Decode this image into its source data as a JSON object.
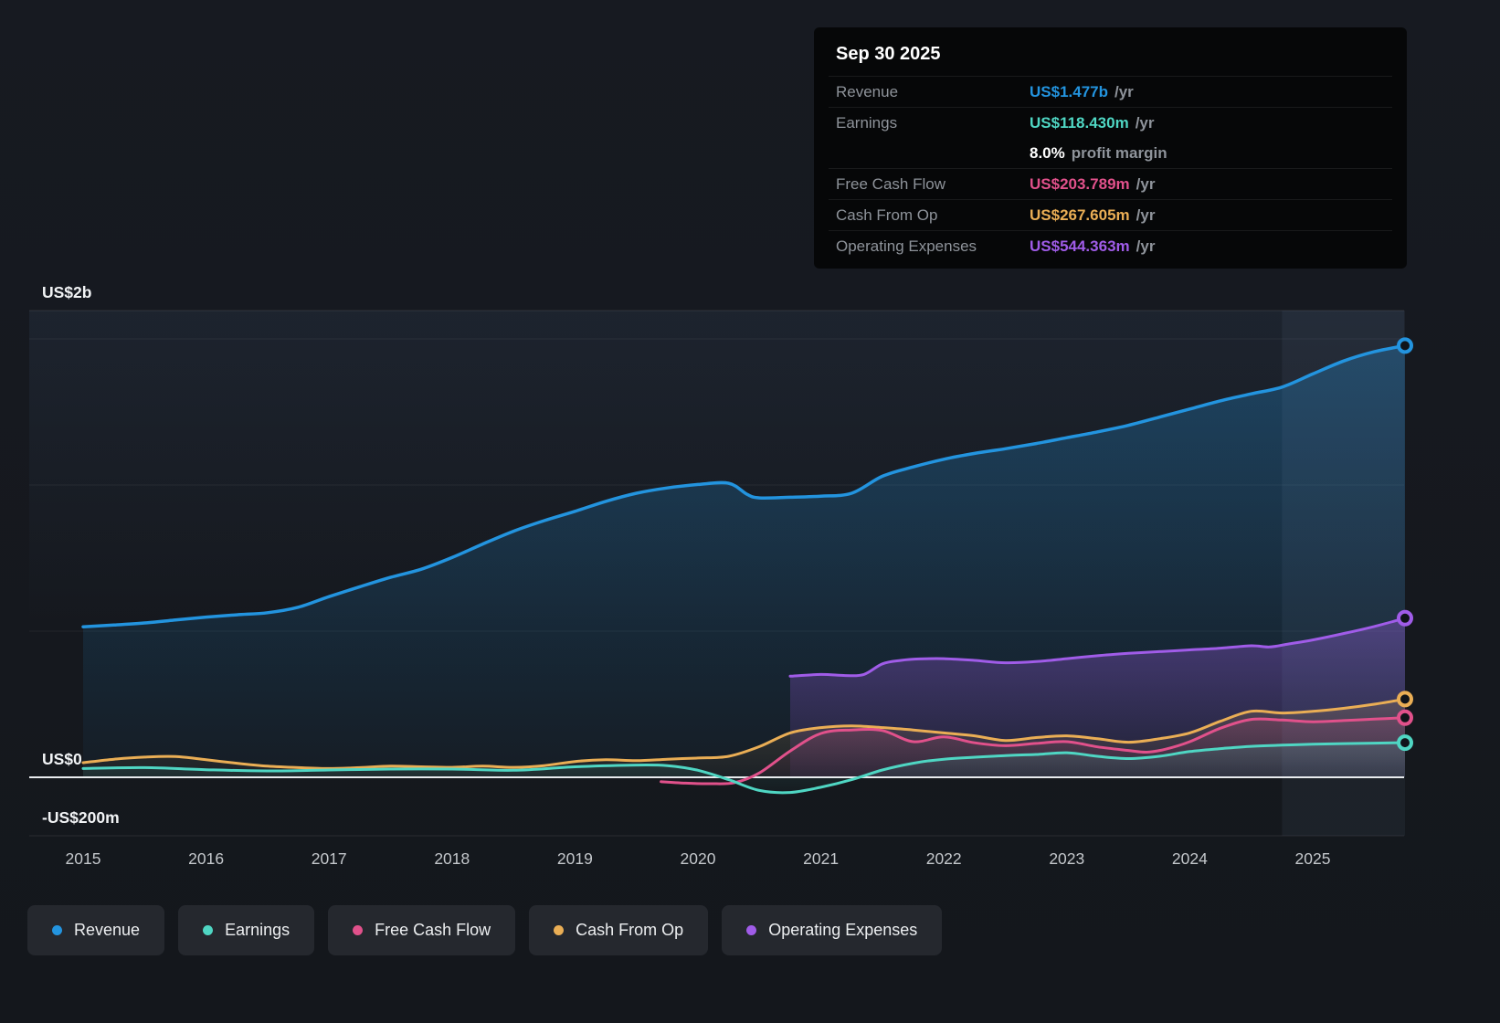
{
  "tooltip": {
    "date": "Sep 30 2025",
    "rows": [
      {
        "label": "Revenue",
        "value": "US$1.477b",
        "suffix": "/yr",
        "color": "#2394df"
      },
      {
        "label": "Earnings",
        "value": "US$118.430m",
        "suffix": "/yr",
        "color": "#4fd6c3"
      },
      {
        "label": "",
        "value": "8.0%",
        "suffix": "profit margin",
        "color": "#ffffff"
      },
      {
        "label": "Free Cash Flow",
        "value": "US$203.789m",
        "suffix": "/yr",
        "color": "#e1518b"
      },
      {
        "label": "Cash From Op",
        "value": "US$267.605m",
        "suffix": "/yr",
        "color": "#eaae55"
      },
      {
        "label": "Operating Expenses",
        "value": "US$544.363m",
        "suffix": "/yr",
        "color": "#a05ce8"
      }
    ]
  },
  "chart_data": {
    "type": "area",
    "title": "",
    "unit": "US$ millions per year",
    "xlim": [
      2015,
      2025.75
    ],
    "ylim": [
      -200,
      1600
    ],
    "grid": "horizontal",
    "legend_position": "bottom-left",
    "x_ticks": [
      "2015",
      "2016",
      "2017",
      "2018",
      "2019",
      "2020",
      "2021",
      "2022",
      "2023",
      "2024",
      "2025"
    ],
    "y_ticks": [
      {
        "label": "US$2b",
        "value": 2000
      },
      {
        "label": "US$0",
        "value": 0
      },
      {
        "label": "-US$200m",
        "value": -200
      }
    ],
    "gridline_values": [
      500,
      1000,
      1500
    ],
    "highlight_region": {
      "from": 2024.75,
      "to": 2025.75
    },
    "series": [
      {
        "name": "Revenue",
        "color": "#2394df",
        "points": [
          [
            2015,
            515
          ],
          [
            2015.25,
            521
          ],
          [
            2015.5,
            528
          ],
          [
            2015.75,
            538
          ],
          [
            2016,
            548
          ],
          [
            2016.25,
            556
          ],
          [
            2016.5,
            563
          ],
          [
            2016.75,
            582
          ],
          [
            2017,
            618
          ],
          [
            2017.25,
            652
          ],
          [
            2017.5,
            684
          ],
          [
            2017.75,
            712
          ],
          [
            2018,
            752
          ],
          [
            2018.25,
            798
          ],
          [
            2018.5,
            842
          ],
          [
            2018.75,
            878
          ],
          [
            2019,
            910
          ],
          [
            2019.25,
            944
          ],
          [
            2019.5,
            972
          ],
          [
            2019.75,
            990
          ],
          [
            2020,
            1002
          ],
          [
            2020.25,
            1006
          ],
          [
            2020.4,
            968
          ],
          [
            2020.5,
            956
          ],
          [
            2020.75,
            958
          ],
          [
            2021,
            962
          ],
          [
            2021.25,
            972
          ],
          [
            2021.5,
            1030
          ],
          [
            2021.75,
            1062
          ],
          [
            2022,
            1088
          ],
          [
            2022.25,
            1108
          ],
          [
            2022.5,
            1124
          ],
          [
            2022.75,
            1142
          ],
          [
            2023,
            1162
          ],
          [
            2023.25,
            1182
          ],
          [
            2023.5,
            1204
          ],
          [
            2023.75,
            1232
          ],
          [
            2024,
            1260
          ],
          [
            2024.25,
            1288
          ],
          [
            2024.5,
            1312
          ],
          [
            2024.75,
            1335
          ],
          [
            2025,
            1380
          ],
          [
            2025.25,
            1424
          ],
          [
            2025.5,
            1456
          ],
          [
            2025.75,
            1477
          ]
        ]
      },
      {
        "name": "Earnings",
        "color": "#4fd6c3",
        "points": [
          [
            2015,
            30
          ],
          [
            2015.5,
            33
          ],
          [
            2016,
            26
          ],
          [
            2016.5,
            22
          ],
          [
            2017,
            25
          ],
          [
            2017.5,
            28
          ],
          [
            2018,
            28
          ],
          [
            2018.5,
            24
          ],
          [
            2019,
            36
          ],
          [
            2019.5,
            42
          ],
          [
            2019.75,
            40
          ],
          [
            2020,
            24
          ],
          [
            2020.25,
            -8
          ],
          [
            2020.5,
            -45
          ],
          [
            2020.75,
            -52
          ],
          [
            2021,
            -34
          ],
          [
            2021.25,
            -8
          ],
          [
            2021.5,
            25
          ],
          [
            2021.75,
            48
          ],
          [
            2022,
            62
          ],
          [
            2022.5,
            74
          ],
          [
            2022.75,
            78
          ],
          [
            2023,
            84
          ],
          [
            2023.25,
            72
          ],
          [
            2023.5,
            64
          ],
          [
            2023.75,
            72
          ],
          [
            2024,
            88
          ],
          [
            2024.25,
            98
          ],
          [
            2024.5,
            106
          ],
          [
            2024.75,
            110
          ],
          [
            2025,
            113
          ],
          [
            2025.5,
            117
          ],
          [
            2025.75,
            118.43
          ]
        ]
      },
      {
        "name": "Free Cash Flow",
        "color": "#e1518b",
        "points": [
          [
            2019.7,
            -15
          ],
          [
            2019.9,
            -20
          ],
          [
            2020.1,
            -22
          ],
          [
            2020.3,
            -18
          ],
          [
            2020.5,
            15
          ],
          [
            2020.75,
            90
          ],
          [
            2021,
            150
          ],
          [
            2021.25,
            162
          ],
          [
            2021.5,
            160
          ],
          [
            2021.75,
            122
          ],
          [
            2022,
            138
          ],
          [
            2022.25,
            118
          ],
          [
            2022.5,
            108
          ],
          [
            2022.75,
            116
          ],
          [
            2023,
            122
          ],
          [
            2023.25,
            104
          ],
          [
            2023.5,
            92
          ],
          [
            2023.65,
            86
          ],
          [
            2023.8,
            96
          ],
          [
            2024,
            122
          ],
          [
            2024.25,
            168
          ],
          [
            2024.5,
            198
          ],
          [
            2024.75,
            196
          ],
          [
            2025,
            190
          ],
          [
            2025.25,
            194
          ],
          [
            2025.5,
            199
          ],
          [
            2025.75,
            203.79
          ]
        ]
      },
      {
        "name": "Cash From Op",
        "color": "#eaae55",
        "points": [
          [
            2015,
            50
          ],
          [
            2015.25,
            62
          ],
          [
            2015.5,
            69
          ],
          [
            2015.75,
            71
          ],
          [
            2016,
            60
          ],
          [
            2016.25,
            48
          ],
          [
            2016.5,
            38
          ],
          [
            2016.75,
            33
          ],
          [
            2017,
            30
          ],
          [
            2017.25,
            33
          ],
          [
            2017.5,
            38
          ],
          [
            2017.75,
            36
          ],
          [
            2018,
            34
          ],
          [
            2018.25,
            38
          ],
          [
            2018.5,
            34
          ],
          [
            2018.75,
            40
          ],
          [
            2019,
            54
          ],
          [
            2019.25,
            60
          ],
          [
            2019.5,
            57
          ],
          [
            2019.75,
            62
          ],
          [
            2020,
            66
          ],
          [
            2020.25,
            72
          ],
          [
            2020.5,
            105
          ],
          [
            2020.75,
            152
          ],
          [
            2021,
            170
          ],
          [
            2021.25,
            176
          ],
          [
            2021.5,
            170
          ],
          [
            2021.75,
            162
          ],
          [
            2022,
            152
          ],
          [
            2022.25,
            142
          ],
          [
            2022.5,
            126
          ],
          [
            2022.75,
            136
          ],
          [
            2023,
            142
          ],
          [
            2023.25,
            132
          ],
          [
            2023.5,
            120
          ],
          [
            2023.75,
            132
          ],
          [
            2024,
            152
          ],
          [
            2024.25,
            192
          ],
          [
            2024.5,
            226
          ],
          [
            2024.75,
            220
          ],
          [
            2025,
            226
          ],
          [
            2025.25,
            236
          ],
          [
            2025.5,
            250
          ],
          [
            2025.75,
            267.61
          ]
        ]
      },
      {
        "name": "Operating Expenses",
        "color": "#a05ce8",
        "points": [
          [
            2020.75,
            346
          ],
          [
            2021,
            352
          ],
          [
            2021.2,
            348
          ],
          [
            2021.35,
            352
          ],
          [
            2021.5,
            388
          ],
          [
            2021.65,
            400
          ],
          [
            2021.8,
            405
          ],
          [
            2022,
            406
          ],
          [
            2022.25,
            400
          ],
          [
            2022.5,
            392
          ],
          [
            2022.75,
            396
          ],
          [
            2023,
            406
          ],
          [
            2023.25,
            416
          ],
          [
            2023.5,
            424
          ],
          [
            2023.75,
            430
          ],
          [
            2024,
            436
          ],
          [
            2024.25,
            442
          ],
          [
            2024.5,
            450
          ],
          [
            2024.65,
            446
          ],
          [
            2024.8,
            456
          ],
          [
            2025,
            470
          ],
          [
            2025.25,
            492
          ],
          [
            2025.5,
            516
          ],
          [
            2025.75,
            544.36
          ]
        ]
      }
    ]
  },
  "legend": {
    "items": [
      {
        "label": "Revenue",
        "color": "#2394df"
      },
      {
        "label": "Earnings",
        "color": "#4fd6c3"
      },
      {
        "label": "Free Cash Flow",
        "color": "#e1518b"
      },
      {
        "label": "Cash From Op",
        "color": "#eaae55"
      },
      {
        "label": "Operating Expenses",
        "color": "#a05ce8"
      }
    ]
  }
}
